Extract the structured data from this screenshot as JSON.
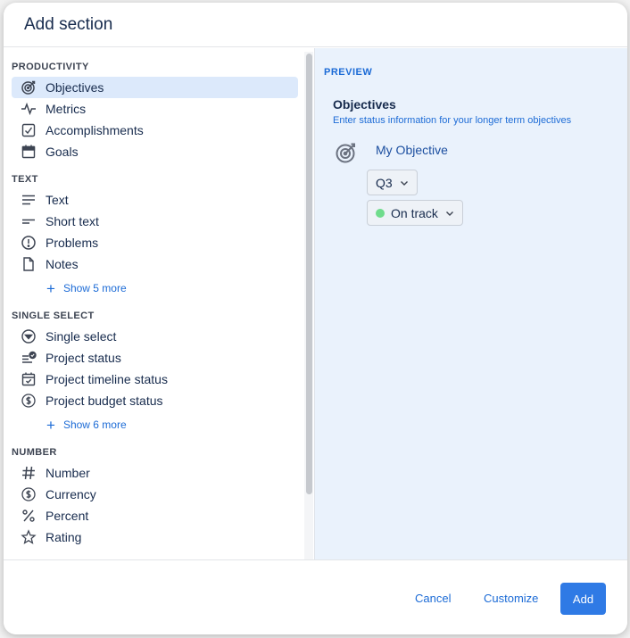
{
  "modal": {
    "title": "Add section"
  },
  "sidebar": {
    "groups": [
      {
        "title": "PRODUCTIVITY",
        "items": [
          {
            "label": "Objectives",
            "icon": "target-icon",
            "selected": true
          },
          {
            "label": "Metrics",
            "icon": "pulse-icon"
          },
          {
            "label": "Accomplishments",
            "icon": "checkbox-icon"
          },
          {
            "label": "Goals",
            "icon": "calendar-icon"
          }
        ]
      },
      {
        "title": "TEXT",
        "items": [
          {
            "label": "Text",
            "icon": "text-lines-icon"
          },
          {
            "label": "Short text",
            "icon": "short-text-icon"
          },
          {
            "label": "Problems",
            "icon": "exclamation-circle-icon"
          },
          {
            "label": "Notes",
            "icon": "document-icon"
          }
        ],
        "show_more": "Show 5 more"
      },
      {
        "title": "SINGLE SELECT",
        "items": [
          {
            "label": "Single select",
            "icon": "dropdown-circle-icon"
          },
          {
            "label": "Project status",
            "icon": "status-list-icon"
          },
          {
            "label": "Project timeline status",
            "icon": "calendar-check-icon"
          },
          {
            "label": "Project budget status",
            "icon": "dollar-circle-icon"
          }
        ],
        "show_more": "Show 6 more"
      },
      {
        "title": "NUMBER",
        "items": [
          {
            "label": "Number",
            "icon": "hash-icon"
          },
          {
            "label": "Currency",
            "icon": "dollar-circle-icon"
          },
          {
            "label": "Percent",
            "icon": "percent-icon"
          },
          {
            "label": "Rating",
            "icon": "star-icon"
          }
        ]
      }
    ]
  },
  "preview": {
    "label": "PREVIEW",
    "title": "Objectives",
    "description": "Enter status information for your longer term objectives",
    "objective_name": "My Objective",
    "quarter": "Q3",
    "status": "On track",
    "status_color": "#6fdc8c"
  },
  "footer": {
    "cancel": "Cancel",
    "customize": "Customize",
    "add": "Add"
  }
}
